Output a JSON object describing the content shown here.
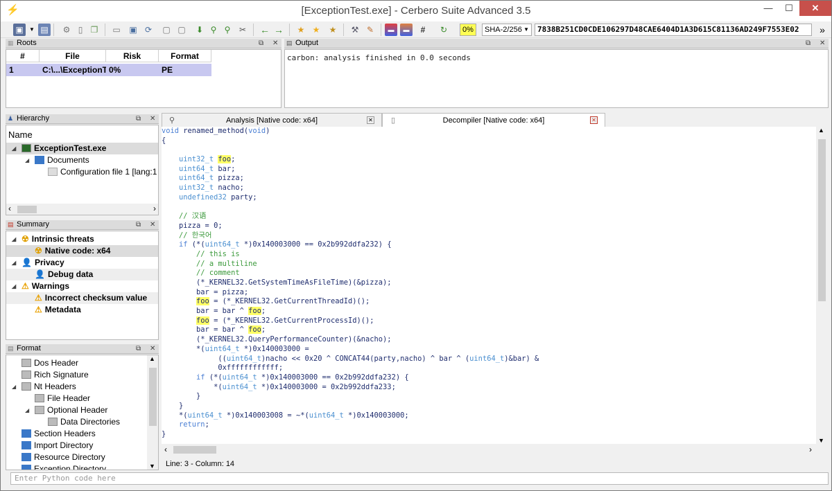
{
  "window": {
    "title": "[ExceptionTest.exe] - Cerbero Suite Advanced 3.5",
    "min_label": "—",
    "max_label": "☐",
    "close_label": "✕"
  },
  "toolbar": {
    "percent": "0%",
    "hash_algo": "SHA-2/256",
    "hash_value": "7838B251CD0CDE106297D48CAE6404D1A3D615C81136AD249F7553E02",
    "overflow_label": "»"
  },
  "roots": {
    "title": "Roots",
    "columns": [
      "#",
      "File",
      "Risk",
      "Format"
    ],
    "row": [
      "1",
      "C:\\...\\ExceptionT",
      "0%",
      "PE"
    ]
  },
  "output": {
    "title": "Output",
    "text": "carbon: analysis finished in 0.0 seconds"
  },
  "hierarchy": {
    "title": "Hierarchy",
    "header": "Name",
    "items": [
      "ExceptionTest.exe",
      "Documents",
      "Configuration file 1 [lang:1"
    ]
  },
  "summary": {
    "title": "Summary",
    "items": [
      "Intrinsic threats",
      "Native code: x64",
      "Privacy",
      "Debug data",
      "Warnings",
      "Incorrect checksum value",
      "Metadata"
    ]
  },
  "format": {
    "title": "Format",
    "items": [
      "Dos Header",
      "Rich Signature",
      "Nt Headers",
      "File Header",
      "Optional Header",
      "Data Directories",
      "Section Headers",
      "Import Directory",
      "Resource Directory",
      "Exception Directory"
    ]
  },
  "tabs": {
    "analysis": "Analysis [Native code: x64]",
    "decompiler": "Decompiler [Native code: x64]"
  },
  "colors": {
    "accent_selection": "#c8c8f0",
    "keyword": "#4a7fd4",
    "comment": "#3c9a3c",
    "highlight": "#ffff66",
    "close_red": "#c7504b"
  },
  "code_lines": [
    "void renamed_method(void)",
    "{",
    "",
    "    uint32_t foo;",
    "    uint64_t bar;",
    "    uint64_t pizza;",
    "    uint32_t nacho;",
    "    undefined32 party;",
    "",
    "    // 汉语",
    "    pizza = 0;",
    "    // 한국어",
    "    if (*(uint64_t *)0x140003000 == 0x2b992ddfa232) {",
    "        // this is",
    "        // a multiline",
    "        // comment",
    "        (*_KERNEL32.GetSystemTimeAsFileTime)(&pizza);",
    "        bar = pizza;",
    "        foo = (*_KERNEL32.GetCurrentThreadId)();",
    "        bar = bar ^ foo;",
    "        foo = (*_KERNEL32.GetCurrentProcessId)();",
    "        bar = bar ^ foo;",
    "        (*_KERNEL32.QueryPerformanceCounter)(&nacho);",
    "        *(uint64_t *)0x140003000 =",
    "             ((uint64_t)nacho << 0x20 ^ CONCAT44(party,nacho) ^ bar ^ (uint64_t)&bar) &",
    "             0xffffffffffff;",
    "        if (*(uint64_t *)0x140003000 == 0x2b992ddfa232) {",
    "            *(uint64_t *)0x140003000 = 0x2b992ddfa233;",
    "        }",
    "    }",
    "    *(uint64_t *)0x140003008 = ~*(uint64_t *)0x140003000;",
    "    return;",
    "}"
  ],
  "status": "Line: 3 - Column: 14",
  "python_input": {
    "placeholder": "Enter Python code here"
  }
}
